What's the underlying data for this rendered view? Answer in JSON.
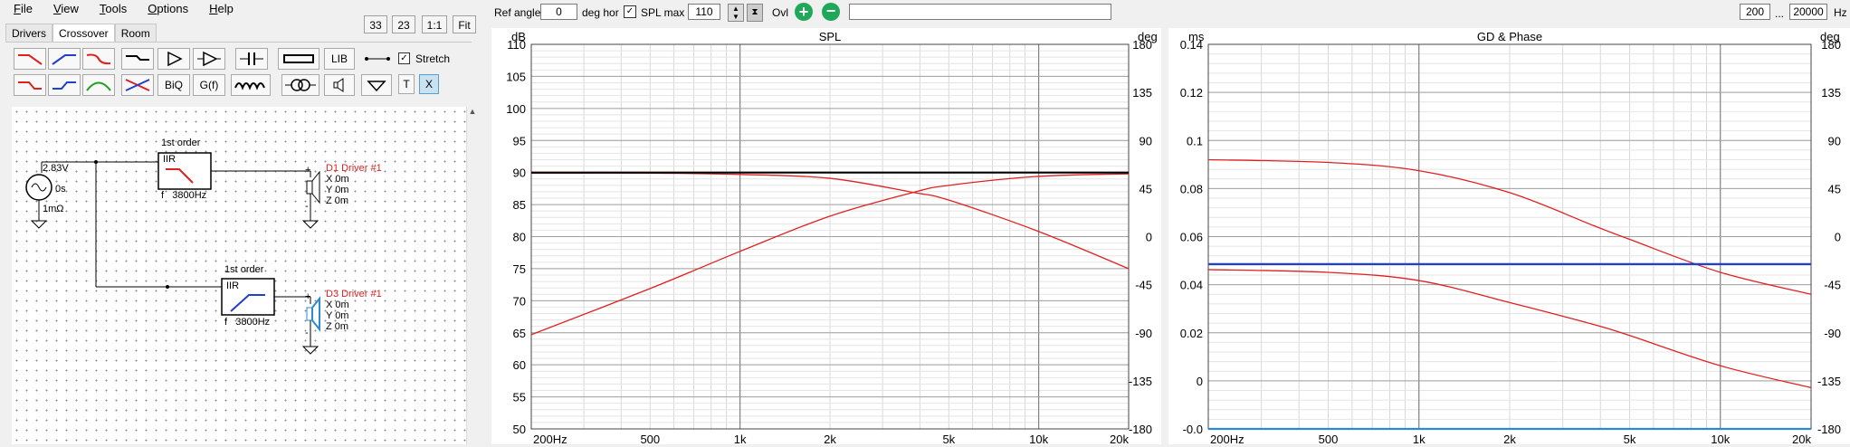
{
  "menu": [
    {
      "underline": "F",
      "rest": "ile"
    },
    {
      "underline": "V",
      "rest": "iew"
    },
    {
      "underline": "T",
      "rest": "ools"
    },
    {
      "underline": "O",
      "rest": "ptions"
    },
    {
      "underline": "H",
      "rest": "elp"
    }
  ],
  "zoom_buttons": [
    "33",
    "23",
    "1:1",
    "Fit"
  ],
  "tabs": [
    "Drivers",
    "Crossover",
    "Room"
  ],
  "toolbar": {
    "lib_label": "LIB",
    "stretch_label": "Stretch",
    "biq_label": "BiQ",
    "gf_label": "G(f)",
    "t_label": "T",
    "x_label": "X"
  },
  "colors": {
    "red": "#e02020",
    "blue": "#1f3fd0",
    "green": "#20a020",
    "lightblue": "#2a8ad8"
  },
  "schematic": {
    "source_voltage": "2.83V",
    "source_delay": "0s",
    "source_res": "1mΩ",
    "block1_title": "1st order",
    "block1_type": "IIR",
    "block1_freq": "f   3800Hz",
    "block2_title": "1st order",
    "block2_type": "IIR",
    "block2_freq": "f   3800Hz",
    "driver1_name": "D1 Driver #1",
    "driver2_name": "D3 Driver #1",
    "pos_x": "X 0m",
    "pos_y": "Y 0m",
    "pos_z": "Z 0m",
    "plus": "+",
    "minus": "-"
  },
  "top_controls": {
    "ref_angle_label": "Ref angle",
    "ref_angle_value": "0",
    "deg_hor_label": "deg hor",
    "spl_max_label": "SPL max",
    "spl_max_value": "110",
    "ovl_label": "Ovl",
    "freq_min": "200",
    "ellipsis": "...",
    "freq_max": "20000",
    "hz_label": "Hz"
  },
  "chart_data": [
    {
      "type": "line",
      "title": "SPL",
      "ylabel": "dB",
      "y2label": "deg",
      "xlim": [
        200,
        20000
      ],
      "ylim": [
        50,
        110
      ],
      "y2lim": [
        -180,
        180
      ],
      "x_scale": "log",
      "x_ticks": [
        "200Hz",
        "500",
        "1k",
        "2k",
        "5k",
        "10k",
        "20k"
      ],
      "y_ticks": [
        "110",
        "105",
        "100",
        "95",
        "90",
        "85",
        "80",
        "75",
        "70",
        "65",
        "60",
        "55",
        "50"
      ],
      "y2_ticks": [
        "180",
        "135",
        "90",
        "45",
        "0",
        "-45",
        "-90",
        "-135",
        "-180"
      ],
      "grid": true,
      "series": [
        {
          "color": "#e02020",
          "x": [
            200,
            500,
            1000,
            2000,
            3800,
            5000,
            10000,
            20000
          ],
          "y": [
            64.7,
            71.9,
            77.7,
            83.2,
            86.9,
            88.0,
            89.4,
            89.8
          ]
        },
        {
          "color": "#e02020",
          "x": [
            200,
            500,
            1000,
            2000,
            3800,
            5000,
            10000,
            20000
          ],
          "y": [
            89.9,
            89.9,
            89.7,
            89.1,
            86.9,
            85.7,
            80.8,
            75.0
          ]
        },
        {
          "color": "#000000",
          "x": [
            200,
            20000
          ],
          "y": [
            90,
            90
          ]
        }
      ]
    },
    {
      "type": "line",
      "title": "GD & Phase",
      "ylabel": "ms",
      "y2label": "deg",
      "xlim": [
        200,
        20000
      ],
      "ylim": [
        0,
        0.14
      ],
      "y2lim": [
        -180,
        180
      ],
      "x_scale": "log",
      "x_ticks": [
        "200Hz",
        "500",
        "1k",
        "2k",
        "5k",
        "10k",
        "20k"
      ],
      "y_ticks": [
        "0.14",
        "0.12",
        "0.1",
        "0.08",
        "0.06",
        "0.04",
        "0.02",
        "0",
        "-0.0"
      ],
      "y2_ticks": [
        "180",
        "135",
        "90",
        "45",
        "0",
        "-45",
        "-90",
        "-135",
        "-180"
      ],
      "grid": true,
      "series": [
        {
          "color": "#e02020",
          "x": [
            200,
            500,
            1000,
            2000,
            3800,
            5000,
            10000,
            20000
          ],
          "y": [
            0.098,
            0.097,
            0.094,
            0.086,
            0.074,
            0.069,
            0.057,
            0.049
          ]
        },
        {
          "color": "#e02020",
          "x": [
            200,
            500,
            1000,
            2000,
            3800,
            5000,
            10000,
            20000
          ],
          "y": [
            0.058,
            0.057,
            0.054,
            0.046,
            0.038,
            0.034,
            0.023,
            0.015
          ]
        },
        {
          "color": "#1f3fd0",
          "x": [
            200,
            20000
          ],
          "y": [
            0.06,
            0.06
          ]
        },
        {
          "color": "#2a8ad8",
          "x": [
            200,
            20000
          ],
          "y": [
            0.0,
            0.0
          ]
        }
      ]
    }
  ]
}
